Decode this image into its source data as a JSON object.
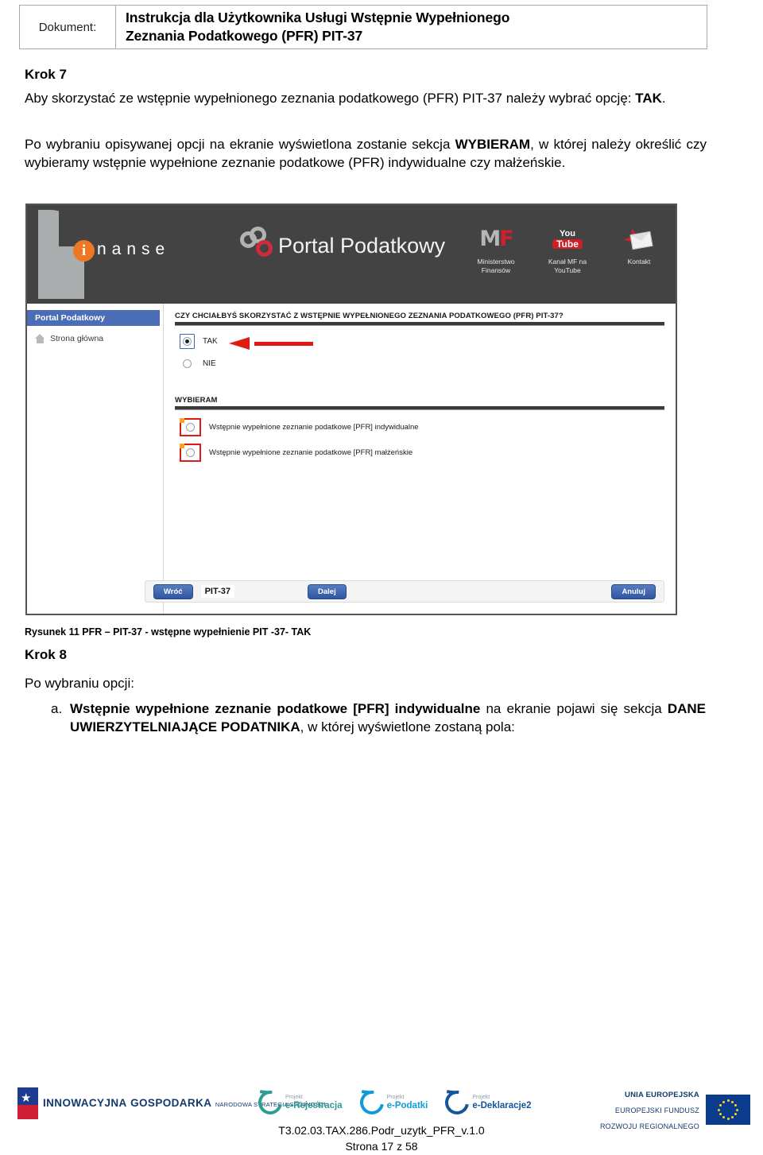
{
  "header": {
    "label": "Dokument:",
    "title_line1": "Instrukcja dla Użytkownika Usługi Wstępnie Wypełnionego",
    "title_line2": "Zeznania Podatkowego (PFR) PIT-37"
  },
  "content": {
    "krok7_heading": "Krok 7",
    "para1": "Aby skorzystać ze wstępnie wypełnionego zeznania podatkowego (PFR) PIT-37 należy wybrać opcję: ",
    "para1_bold": "TAK",
    "para1_end": ".",
    "para2_a": "Po wybraniu opisywanej opcji na ekranie wyświetlona zostanie sekcja ",
    "para2_bold": "WYBIERAM",
    "para2_b": ", w której należy określić czy wybieramy wstępnie wypełnione zeznanie podatkowe (PFR) indywidualne czy małżeńskie.",
    "caption": "Rysunek 11 PFR – PIT-37 - wstępne wypełnienie PIT -37- TAK",
    "krok8_heading": "Krok 8",
    "para3": "Po wybraniu opcji:",
    "list_marker": "a.",
    "list_bold1": "Wstępnie wypełnione zeznanie podatkowe [PFR] indywidualne",
    "list_mid1": " na ekranie pojawi się sekcja ",
    "list_bold2": "DANE UWIERZYTELNIAJĄCE PODATNIKA",
    "list_end": ", w której wyświetlone zostaną pola:"
  },
  "screenshot": {
    "logo": {
      "finanse_i": "i",
      "finanse_text": "nanse",
      "portal_title": "Portal Podatkowy"
    },
    "header_icons": [
      {
        "name": "ministerstwo-finansow-icon",
        "mark_m": "M",
        "mark_f": "F",
        "caption_line1": "Ministerstwo",
        "caption_line2": "Finansów"
      },
      {
        "name": "youtube-icon",
        "you": "You",
        "tube": "Tube",
        "caption_line1": "Kanał MF na",
        "caption_line2": "YouTube"
      },
      {
        "name": "kontakt-icon",
        "caption_line1": "Kontakt",
        "caption_line2": ""
      }
    ],
    "sidebar": {
      "heading": "Portal Podatkowy",
      "item_home": "Strona główna"
    },
    "main": {
      "question_heading": "CZY CHCIAŁBYŚ SKORZYSTAĆ Z WSTĘPNIE WYPEŁNIONEGO ZEZNANIA PODATKOWEGO (PFR) PIT-37?",
      "option_tak": "TAK",
      "option_nie": "NIE",
      "wybieram_heading": "WYBIERAM",
      "option_indywidualne": "Wstępnie wypełnione zeznanie podatkowe [PFR] indywidualne",
      "option_malzenskie": "Wstępnie wypełnione zeznanie podatkowe [PFR] małżeńskie",
      "selected_option": "TAK"
    },
    "buttons": {
      "back": "Wróć",
      "form_chip": "PIT-37",
      "next": "Dalej",
      "cancel": "Anuluj"
    },
    "colors": {
      "topbar_bg": "#434343",
      "sidebar_heading_bg": "#4a6db5",
      "button_blue": "#3b62ad",
      "highlight_red": "#e01a15",
      "accent_orange": "#ef7622"
    }
  },
  "footer": {
    "innowacyjna": {
      "line1": "INNOWACYJNA",
      "line2": "GOSPODARKA",
      "line3": "NARODOWA STRATEGIA SPÓJNOŚCI"
    },
    "projects": [
      {
        "small": "Projekt",
        "name": "e-Rejestracja",
        "color": "#2f9b93"
      },
      {
        "small": "Projekt",
        "name": "e-Podatki",
        "color": "#0f9bd8"
      },
      {
        "small": "Projekt",
        "name": "e-Deklaracje2",
        "color": "#14559c"
      }
    ],
    "eu": {
      "line1": "UNIA EUROPEJSKA",
      "line2": "EUROPEJSKI FUNDUSZ",
      "line3": "ROZWOJU REGIONALNEGO"
    },
    "doc_code": "T3.02.03.TAX.286.Podr_uzytk_PFR_v.1.0",
    "page_label": "Strona 17 z 58"
  }
}
